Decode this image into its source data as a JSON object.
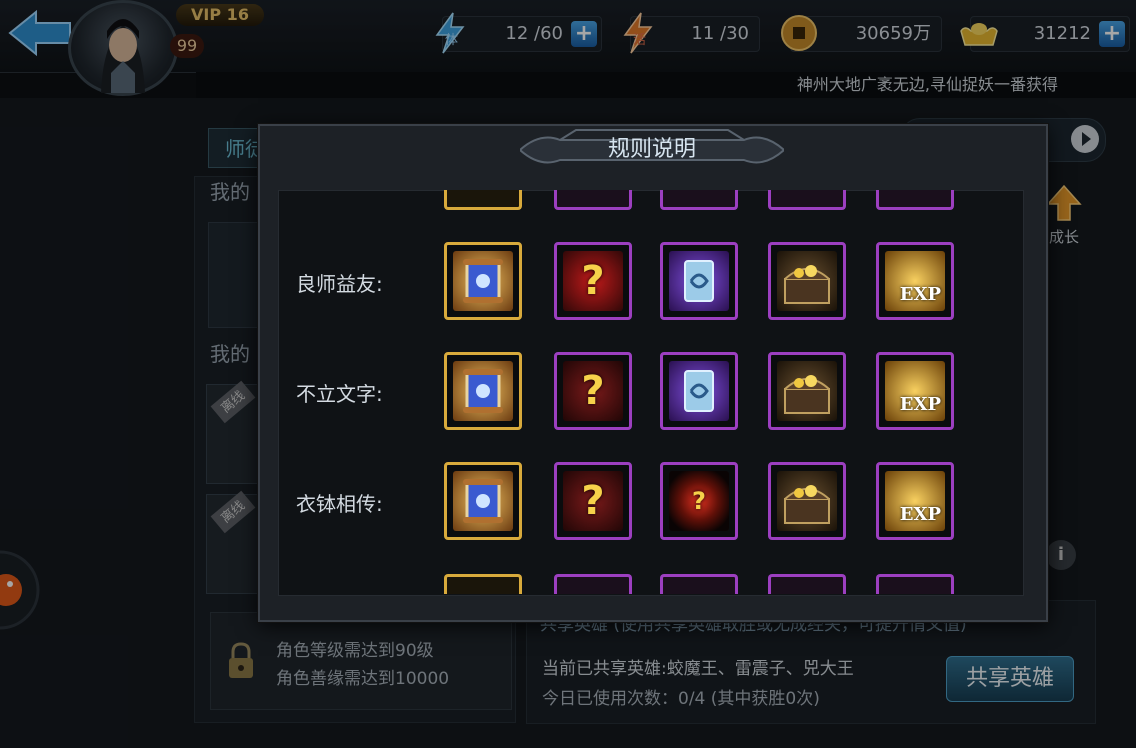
{
  "top_bar": {
    "vip_label": "VIP 16",
    "player_level": "99",
    "stamina": {
      "label": "体",
      "value": "12 /60"
    },
    "vigor": {
      "label": "活",
      "value": "11 /30"
    },
    "coins": {
      "value": "30659万"
    },
    "gold": {
      "value": "31212"
    },
    "plus_label": "+"
  },
  "notice": "神州大地广袤无边,寻仙捉妖一番获得",
  "background": {
    "tab_label": "师徒",
    "my_label_1": "我的",
    "my_label_2": "我的",
    "offline_tag": "离线",
    "requirements": [
      "角色等级需达到90级",
      "角色善缘需达到10000"
    ],
    "share_title": "共享英雄 (使用共享英雄取胜或无成经关，可提升情义值)",
    "shared_heroes": "当前已共享英雄:蛟魔王、雷震子、兕大王",
    "use_count": "今日已使用次数：0/4 (其中获胜0次)",
    "share_button": "共享英雄",
    "grow_label": "成长",
    "info_label": "i"
  },
  "modal": {
    "title": "规则说明",
    "rows": [
      {
        "label": "良师益友:",
        "items": [
          "scroll",
          "mystery-hero",
          "talisman",
          "treasure-chest",
          "exp"
        ]
      },
      {
        "label": "不立文字:",
        "items": [
          "scroll",
          "mystery-hero",
          "talisman",
          "treasure-chest",
          "exp"
        ]
      },
      {
        "label": "衣钵相传:",
        "items": [
          "scroll",
          "mystery-hero",
          "mystery-orb",
          "treasure-chest",
          "exp"
        ]
      }
    ],
    "exp_text": "EXP",
    "question_mark": "?"
  },
  "colors": {
    "gold_border": "#d8aa3c",
    "purple_border": "#9c3fc0",
    "accent_blue": "#4aa6e8"
  }
}
